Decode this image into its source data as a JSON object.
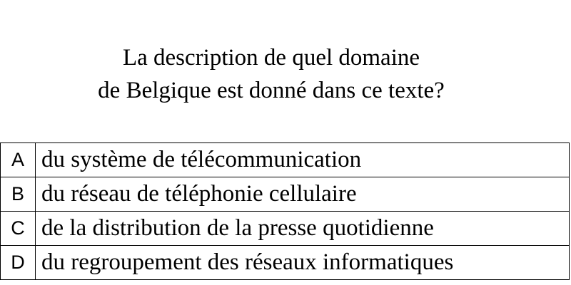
{
  "question": {
    "line1": "La description de quel domaine",
    "line2": "de Belgique est donné dans ce texte?"
  },
  "options": [
    {
      "letter": "A",
      "text": "du système de télécommunication"
    },
    {
      "letter": "B",
      "text": "du réseau de téléphonie cellulaire"
    },
    {
      "letter": "C",
      "text": "de la distribution de la presse quotidienne"
    },
    {
      "letter": "D",
      "text": "du regroupement des réseaux informatiques"
    }
  ]
}
